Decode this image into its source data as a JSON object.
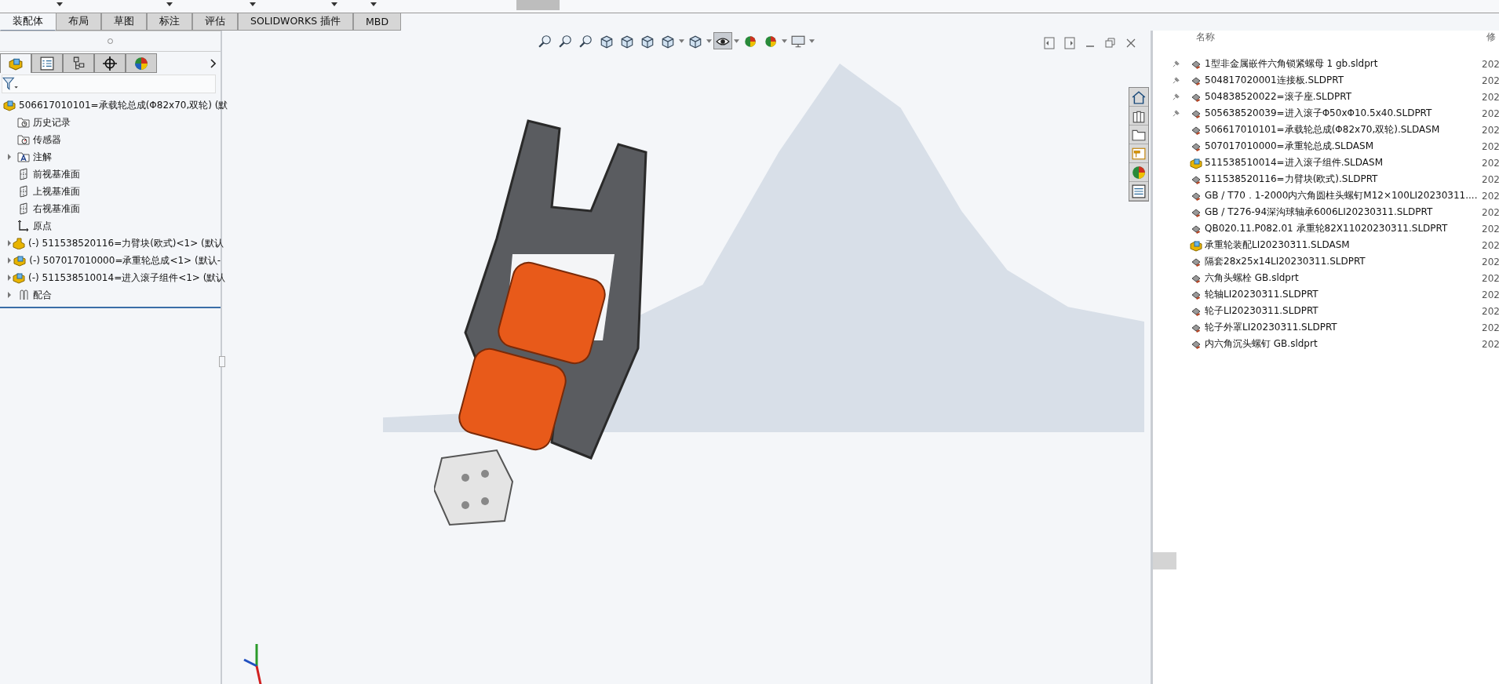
{
  "tabs": [
    {
      "label": "装配体",
      "selected": true
    },
    {
      "label": "布局",
      "selected": false
    },
    {
      "label": "草图",
      "selected": false
    },
    {
      "label": "标注",
      "selected": false
    },
    {
      "label": "评估",
      "selected": false
    },
    {
      "label": "SOLIDWORKS 插件",
      "selected": false
    },
    {
      "label": "MBD",
      "selected": false
    }
  ],
  "panel_tabs": [
    {
      "kind": "feature-tree",
      "selected": true
    },
    {
      "kind": "property",
      "selected": false
    },
    {
      "kind": "config",
      "selected": false
    },
    {
      "kind": "dimxpert",
      "selected": false
    },
    {
      "kind": "display",
      "selected": false
    }
  ],
  "feature_tree": {
    "root": {
      "label": "506617010101=承载轮总成(Φ82x70,双轮)  (默",
      "kind": "assembly",
      "children": [
        {
          "label": "历史记录",
          "kind": "history"
        },
        {
          "label": "传感器",
          "kind": "sensor"
        },
        {
          "label": "注解",
          "kind": "annotation",
          "expanded": false
        },
        {
          "label": "前视基准面",
          "kind": "plane"
        },
        {
          "label": "上视基准面",
          "kind": "plane"
        },
        {
          "label": "右视基准面",
          "kind": "plane"
        },
        {
          "label": "原点",
          "kind": "origin"
        },
        {
          "label": "(-) 511538520116=力臂块(欧式)<1> (默认",
          "kind": "part",
          "expanded": false
        },
        {
          "label": "(-) 507017010000=承重轮总成<1> (默认-",
          "kind": "assembly",
          "expanded": false
        },
        {
          "label": "(-) 511538510014=进入滚子组件<1> (默认",
          "kind": "assembly",
          "expanded": false
        },
        {
          "label": "配合",
          "kind": "mate",
          "expanded": false
        }
      ]
    }
  },
  "view_toolbar": [
    {
      "kind": "zoom-fit",
      "dropdown": false,
      "selected": false
    },
    {
      "kind": "zoom-area",
      "dropdown": false,
      "selected": false
    },
    {
      "kind": "zoom-box",
      "dropdown": false,
      "selected": false
    },
    {
      "kind": "previous-view",
      "dropdown": false,
      "selected": false
    },
    {
      "kind": "section",
      "dropdown": false,
      "selected": false
    },
    {
      "kind": "dynamic-annotation",
      "dropdown": false,
      "selected": false
    },
    {
      "kind": "view-orientation",
      "dropdown": true,
      "selected": false
    },
    {
      "kind": "display-style",
      "dropdown": true,
      "selected": false
    },
    {
      "kind": "hide-show",
      "dropdown": true,
      "selected": true
    },
    {
      "kind": "edit-appearance",
      "dropdown": false,
      "selected": false
    },
    {
      "kind": "scene",
      "dropdown": true,
      "selected": false
    },
    {
      "kind": "display-settings",
      "dropdown": true,
      "selected": false
    }
  ],
  "task_pane_tabs": [
    {
      "kind": "home",
      "selected": false
    },
    {
      "kind": "library",
      "selected": false
    },
    {
      "kind": "explorer",
      "selected": false
    },
    {
      "kind": "palette",
      "selected": false
    },
    {
      "kind": "appearance",
      "selected": false
    },
    {
      "kind": "properties",
      "selected": false
    }
  ],
  "file_list": {
    "columns": [
      "名称",
      "修"
    ],
    "rows": [
      {
        "name": "1型非金属嵌件六角锁紧螺母 1 gb.sldprt",
        "kind": "part",
        "pinned": true,
        "modified": "202"
      },
      {
        "name": "504817020001连接板.SLDPRT",
        "kind": "part",
        "pinned": true,
        "modified": "202"
      },
      {
        "name": "504838520022=滚子座.SLDPRT",
        "kind": "part",
        "pinned": true,
        "modified": "202"
      },
      {
        "name": "505638520039=进入滚子Φ50xΦ10.5x40.SLDPRT",
        "kind": "part",
        "pinned": true,
        "modified": "202"
      },
      {
        "name": "506617010101=承载轮总成(Φ82x70,双轮).SLDASM",
        "kind": "part",
        "pinned": false,
        "modified": "202"
      },
      {
        "name": "507017010000=承重轮总成.SLDASM",
        "kind": "part",
        "pinned": false,
        "modified": "202"
      },
      {
        "name": "511538510014=进入滚子组件.SLDASM",
        "kind": "assembly",
        "pinned": false,
        "modified": "202"
      },
      {
        "name": "511538520116=力臂块(欧式).SLDPRT",
        "kind": "part",
        "pinned": false,
        "modified": "202"
      },
      {
        "name": "GB / T70．1-2000内六角圆柱头螺钉M12×100LI20230311....",
        "kind": "part",
        "pinned": false,
        "modified": "202"
      },
      {
        "name": "GB / T276-94深沟球轴承6006LI20230311.SLDPRT",
        "kind": "part",
        "pinned": false,
        "modified": "202"
      },
      {
        "name": "QB020.11.P082.01 承重轮82X11020230311.SLDPRT",
        "kind": "part",
        "pinned": false,
        "modified": "202"
      },
      {
        "name": "承重轮装配LI20230311.SLDASM",
        "kind": "assembly",
        "pinned": false,
        "modified": "202"
      },
      {
        "name": "隔套28x25x14LI20230311.SLDPRT",
        "kind": "part",
        "pinned": false,
        "modified": "202"
      },
      {
        "name": "六角头螺栓 GB.sldprt",
        "kind": "part",
        "pinned": false,
        "modified": "202"
      },
      {
        "name": "轮轴LI20230311.SLDPRT",
        "kind": "part",
        "pinned": false,
        "modified": "202"
      },
      {
        "name": "轮子LI20230311.SLDPRT",
        "kind": "part",
        "pinned": false,
        "modified": "202"
      },
      {
        "name": "轮子外罩LI20230311.SLDPRT",
        "kind": "part",
        "pinned": false,
        "modified": "202"
      },
      {
        "name": "内六角沉头螺钉 GB.sldprt",
        "kind": "part",
        "pinned": false,
        "modified": "202"
      }
    ]
  }
}
